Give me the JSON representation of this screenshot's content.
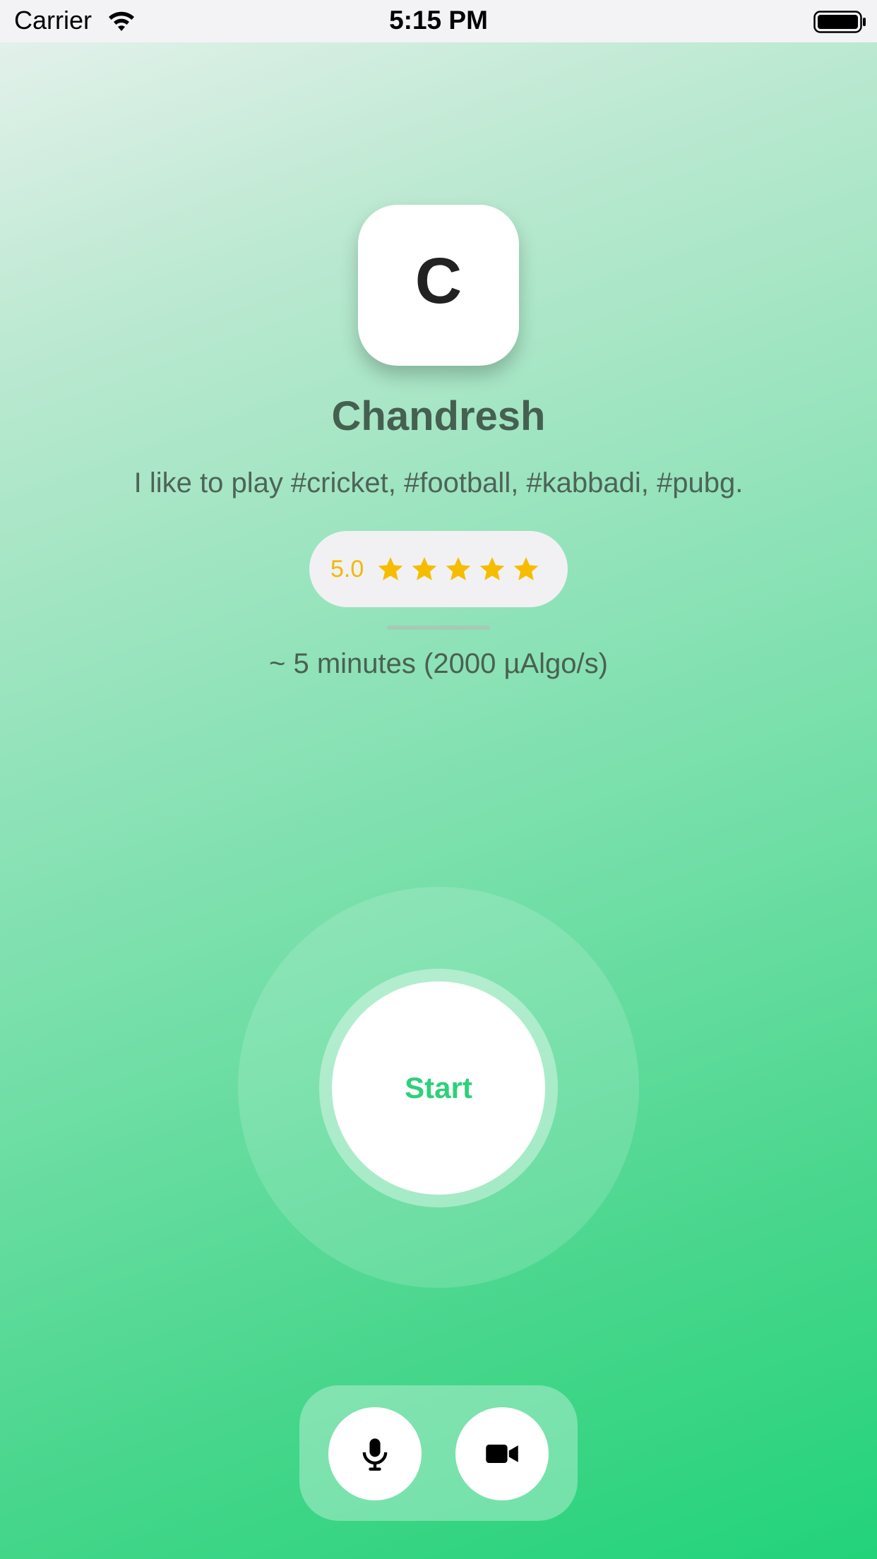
{
  "status_bar": {
    "carrier": "Carrier",
    "time": "5:15 PM"
  },
  "profile": {
    "avatar_initial": "C",
    "name": "Chandresh",
    "bio": "I like to play #cricket, #football, #kabbadi, #pubg.",
    "rating_text": "5.0",
    "rating_stars": 5,
    "rating_max": 5,
    "duration": "~ 5 minutes (2000 µAlgo/s)"
  },
  "start_button": {
    "label": "Start"
  },
  "controls": {
    "mic_icon": "microphone-icon",
    "video_icon": "video-camera-icon"
  },
  "colors": {
    "accent_green": "#2fd07a",
    "star_yellow": "#f3b800",
    "text_dark_green": "#456050"
  }
}
